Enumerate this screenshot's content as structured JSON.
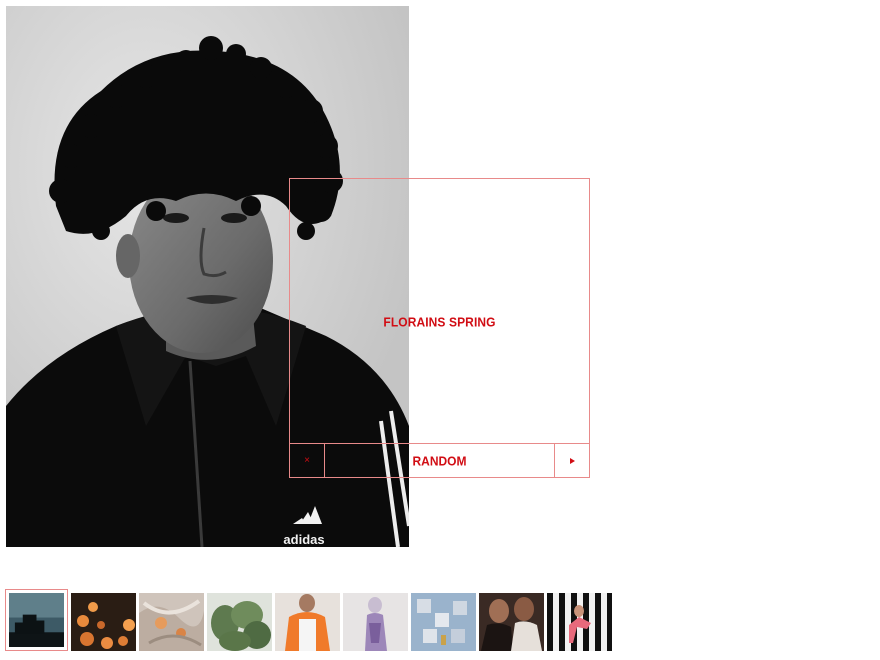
{
  "card": {
    "title": "FLORAINS SPRING",
    "random_label": "RANDOM",
    "close_glyph": "×",
    "next_icon": "play-triangle-icon"
  },
  "hero": {
    "logo_text": "adidas",
    "image_desc_icon": "portrait-photo"
  },
  "thumbnails": [
    {
      "name": "thumb-dark-sculpture",
      "active": true
    },
    {
      "name": "thumb-orange-balls",
      "active": false
    },
    {
      "name": "thumb-plastic-bags",
      "active": false
    },
    {
      "name": "thumb-plants",
      "active": false
    },
    {
      "name": "thumb-orange-jacket",
      "active": false
    },
    {
      "name": "thumb-lilac-figure",
      "active": false
    },
    {
      "name": "thumb-architecture",
      "active": false
    },
    {
      "name": "thumb-portraits-duo",
      "active": false
    },
    {
      "name": "thumb-striped-dancer",
      "active": false
    }
  ],
  "colors": {
    "accent_red": "#d10d14",
    "border_red": "#e88a8a"
  }
}
